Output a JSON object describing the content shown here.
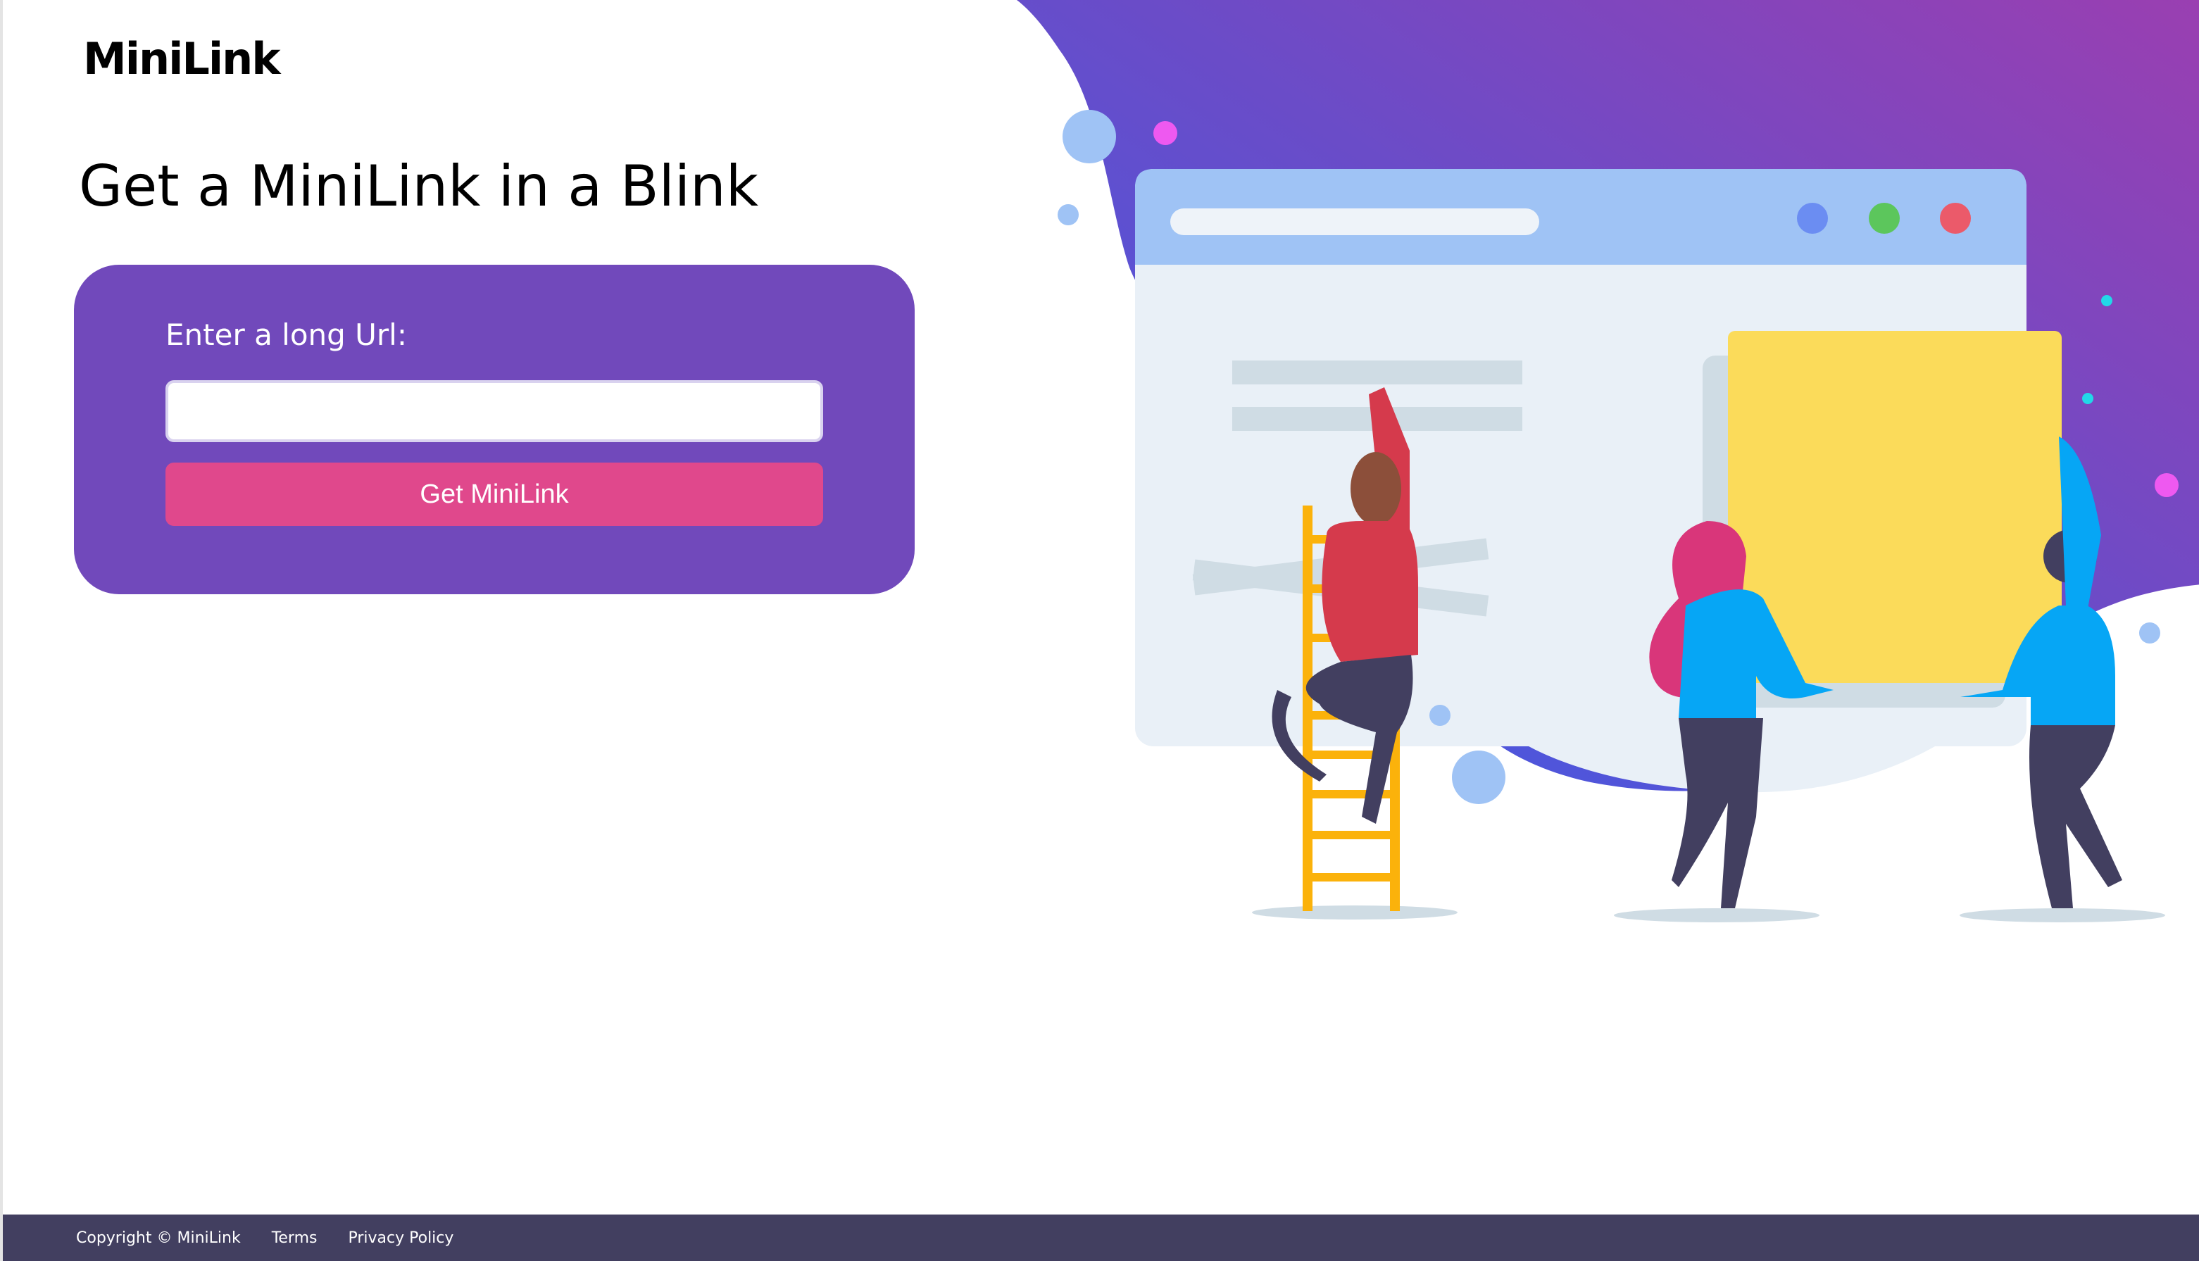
{
  "header": {
    "logo_text": "MiniLink"
  },
  "hero": {
    "headline": "Get a MiniLink in a Blink"
  },
  "form": {
    "label": "Enter a long Url:",
    "input_value": "",
    "input_placeholder": "",
    "submit_label": "Get MiniLink"
  },
  "footer": {
    "copyright": "Copyright © MiniLink",
    "terms": "Terms",
    "privacy": "Privacy Policy"
  },
  "colors": {
    "card_purple": "#7149bb",
    "button_pink": "#e0488c",
    "footer_navy": "#423f60",
    "blob_gradient_start": "#5a52d6",
    "blob_gradient_end": "#9b3fb0"
  },
  "illustration": {
    "description_icons": [
      "browser-window-illustration",
      "ladder-person-illustration",
      "people-carrying-card-illustration"
    ]
  }
}
